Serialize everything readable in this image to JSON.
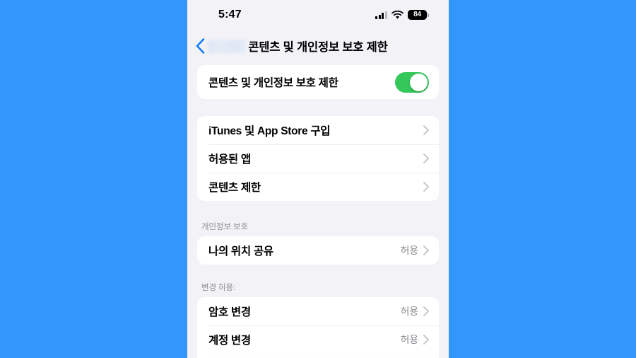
{
  "colors": {
    "page_background": "#3396FB",
    "screen_background": "#F2F2F7",
    "card_background": "#FFFFFF",
    "toggle_on": "#34C759",
    "accent_blue": "#007AFF",
    "secondary_text": "#8E8E93"
  },
  "status_bar": {
    "time": "5:47",
    "cellular_icon": "cellular-bars-icon",
    "wifi_icon": "wifi-icon",
    "battery_icon": "battery-icon",
    "battery_percent": "84"
  },
  "nav_bar": {
    "back_icon": "chevron-left-icon",
    "back_label": "",
    "title": "콘텐츠 및 개인정보 보호 제한"
  },
  "sections": [
    {
      "header": "",
      "rows": [
        {
          "label": "콘텐츠 및 개인정보 보호 제한",
          "type": "toggle",
          "value": "on"
        }
      ]
    },
    {
      "header": "",
      "rows": [
        {
          "label": "iTunes 및 App Store 구입",
          "type": "disclosure",
          "value": ""
        },
        {
          "label": "허용된 앱",
          "type": "disclosure",
          "value": ""
        },
        {
          "label": "콘텐츠 제한",
          "type": "disclosure",
          "value": ""
        }
      ]
    },
    {
      "header": "개인정보 보호",
      "rows": [
        {
          "label": "나의 위치 공유",
          "type": "disclosure",
          "value": "허용"
        }
      ]
    },
    {
      "header": "변경 허용:",
      "rows": [
        {
          "label": "암호 변경",
          "type": "disclosure",
          "value": "허용"
        },
        {
          "label": "계정 변경",
          "type": "disclosure",
          "value": "허용"
        },
        {
          "label": "",
          "type": "partial",
          "value": ""
        }
      ]
    }
  ]
}
